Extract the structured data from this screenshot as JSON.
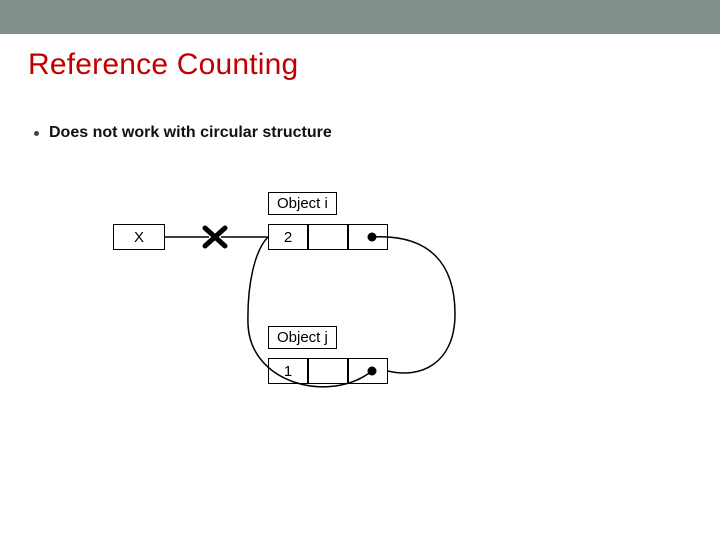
{
  "slide": {
    "title": "Reference Counting",
    "bullet": "Does not work with circular structure"
  },
  "diagram": {
    "var_x": "X",
    "object_i": {
      "label": "Object i",
      "refcount": "2"
    },
    "object_j": {
      "label": "Object j",
      "refcount": "1"
    }
  }
}
